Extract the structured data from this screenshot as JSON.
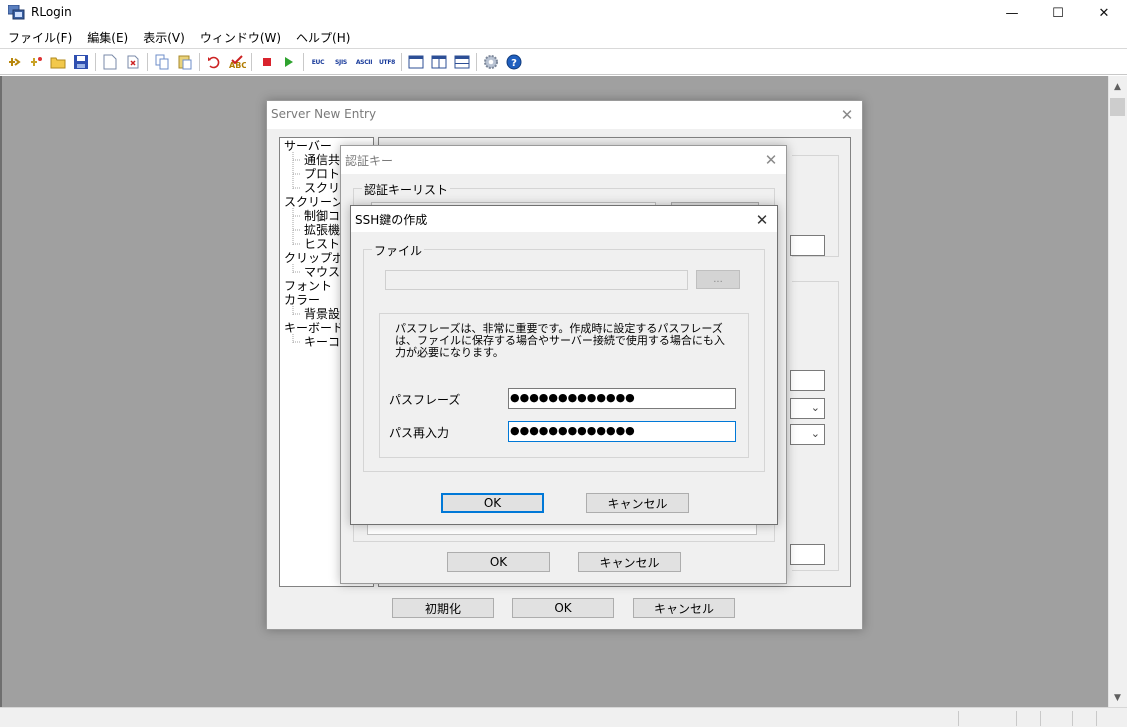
{
  "window": {
    "title": "RLogin",
    "controls": {
      "minimize": "—",
      "maximize": "☐",
      "close": "✕"
    }
  },
  "menu": [
    "ファイル(F)",
    "編集(E)",
    "表示(V)",
    "ウィンドウ(W)",
    "ヘルプ(H)"
  ],
  "toolbar": {
    "text_buttons": [
      "EUC",
      "SJIS",
      "ASCII",
      "UTF8"
    ]
  },
  "server_dialog": {
    "title": "Server New Entry",
    "tree": [
      {
        "label": "サーバー",
        "level": 0
      },
      {
        "label": "通信共",
        "level": 1
      },
      {
        "label": "プロトコ",
        "level": 1
      },
      {
        "label": "スクリプ",
        "level": 1
      },
      {
        "label": "スクリーン",
        "level": 0
      },
      {
        "label": "制御コ",
        "level": 1
      },
      {
        "label": "拡張機",
        "level": 1
      },
      {
        "label": "ヒストリ",
        "level": 1
      },
      {
        "label": "クリップボード",
        "level": 0
      },
      {
        "label": "マウス関",
        "level": 1
      },
      {
        "label": "フォント",
        "level": 0
      },
      {
        "label": "カラー",
        "level": 0
      },
      {
        "label": "背景設",
        "level": 1
      },
      {
        "label": "キーボード",
        "level": 0
      },
      {
        "label": "キーコー",
        "level": 1
      }
    ],
    "buttons": {
      "reset": "初期化",
      "ok": "OK",
      "cancel": "キャンセル"
    }
  },
  "auth_dialog": {
    "title": "認証キー",
    "group_label": "認証キーリスト",
    "buttons": {
      "ok": "OK",
      "cancel": "キャンセル"
    }
  },
  "ssh_dialog": {
    "title": "SSH鍵の作成",
    "file_group_label": "ファイル",
    "file_path": "",
    "browse_label": "...",
    "description": "パスフレーズは、非常に重要です。作成時に設定するパスフレーズは、ファイルに保存する場合やサーバー接続で使用する場合にも入力が必要になります。",
    "passphrase_label": "パスフレーズ",
    "passphrase_value": "●●●●●●●●●●●●●",
    "reenter_label": "パス再入力",
    "reenter_value": "●●●●●●●●●●●●●",
    "buttons": {
      "ok": "OK",
      "cancel": "キャンセル"
    }
  }
}
